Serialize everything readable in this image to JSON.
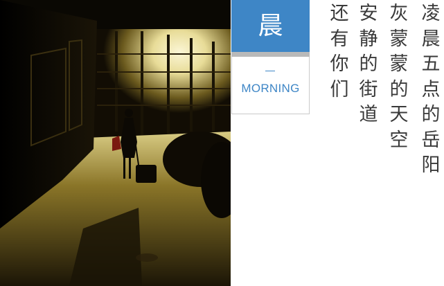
{
  "photo": {
    "alt": "airport corridor silhouette",
    "colors": {
      "dark": "#0d0a05",
      "glow": "#f3edc0",
      "floor": "#6a5a20"
    }
  },
  "badge": {
    "char": "晨",
    "dash": "—",
    "word": "MORNING",
    "colors": {
      "accent": "#3e86c6",
      "separator": "#b9b9b9"
    }
  },
  "poem": {
    "lines": [
      "凌晨五点的岳阳",
      "灰蒙蒙的天空",
      "安静的街道",
      "还有你们"
    ],
    "color": "#3a3a3a"
  }
}
